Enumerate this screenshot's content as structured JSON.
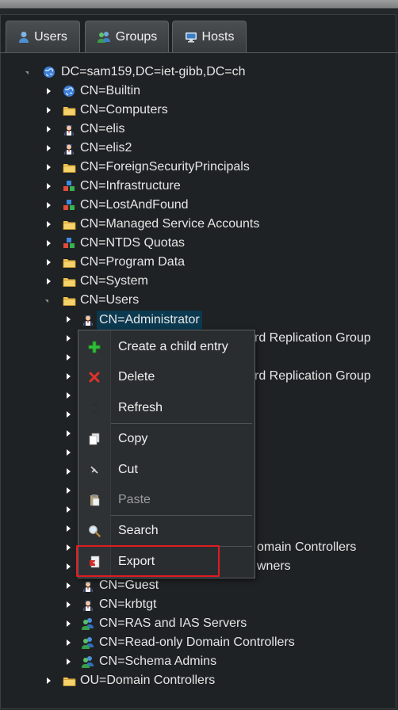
{
  "tabs": [
    {
      "label": "Users",
      "icon": "user-icon"
    },
    {
      "label": "Groups",
      "icon": "group-icon"
    },
    {
      "label": "Hosts",
      "icon": "monitor-icon"
    }
  ],
  "tree": {
    "root": "DC=sam159,DC=iet-gibb,DC=ch",
    "children": [
      {
        "label": "CN=Builtin",
        "icon": "globe-icon"
      },
      {
        "label": "CN=Computers",
        "icon": "folder-icon"
      },
      {
        "label": "CN=elis",
        "icon": "person-icon"
      },
      {
        "label": "CN=elis2",
        "icon": "person-icon"
      },
      {
        "label": "CN=ForeignSecurityPrincipals",
        "icon": "folder-icon"
      },
      {
        "label": "CN=Infrastructure",
        "icon": "blocks-icon"
      },
      {
        "label": "CN=LostAndFound",
        "icon": "blocks-icon"
      },
      {
        "label": "CN=Managed Service Accounts",
        "icon": "folder-icon"
      },
      {
        "label": "CN=NTDS Quotas",
        "icon": "blocks-icon"
      },
      {
        "label": "CN=Program Data",
        "icon": "folder-icon"
      },
      {
        "label": "CN=System",
        "icon": "folder-icon"
      },
      {
        "label": "CN=Users",
        "icon": "folder-icon"
      }
    ],
    "users_children": [
      {
        "label": "CN=Administrator",
        "icon": "person-icon"
      },
      {
        "label": "rd Replication Group"
      },
      {
        "label": "rd Replication Group"
      },
      {
        "label": "omain Controllers"
      },
      {
        "label": "wners"
      },
      {
        "label": "CN=Guest",
        "icon": "person-icon"
      },
      {
        "label": "CN=krbtgt",
        "icon": "person-icon"
      },
      {
        "label": "CN=RAS and IAS Servers",
        "icon": "group-icon"
      },
      {
        "label": "CN=Read-only Domain Controllers",
        "icon": "group-icon"
      },
      {
        "label": "CN=Schema Admins",
        "icon": "group-icon"
      }
    ],
    "last": {
      "label": "OU=Domain Controllers",
      "icon": "folder-icon"
    }
  },
  "context_menu": [
    {
      "label": "Create a child entry",
      "icon": "plus-icon"
    },
    {
      "label": "Delete",
      "icon": "x-icon"
    },
    {
      "label": "Refresh",
      "icon": "refresh-icon"
    },
    {
      "label": "Copy",
      "icon": "copy-icon"
    },
    {
      "label": "Cut",
      "icon": "scissors-icon"
    },
    {
      "label": "Paste",
      "icon": "paste-icon",
      "disabled": true
    },
    {
      "label": "Search",
      "icon": "magnifier-icon"
    },
    {
      "label": "Export",
      "icon": "export-icon"
    }
  ],
  "colors": {
    "highlight_border": "#e11b22",
    "selection": "#0b3950"
  }
}
